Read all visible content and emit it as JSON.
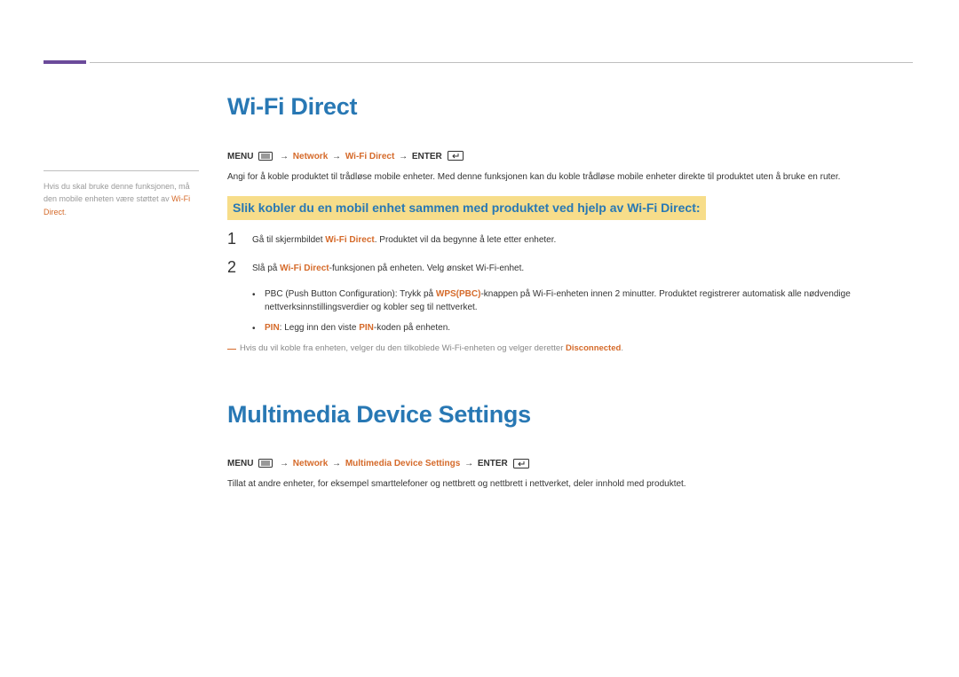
{
  "sidebar": {
    "text_prefix": "Hvis du skal bruke denne funksjonen, må den mobile enheten være støttet av ",
    "highlight": "Wi-Fi Direct",
    "suffix": "."
  },
  "section1": {
    "title": "Wi-Fi Direct",
    "nav_menu": "MENU",
    "nav_network": "Network",
    "nav_item": "Wi-Fi Direct",
    "nav_enter": "ENTER",
    "intro": "Angi for å koble produktet til trådløse mobile enheter. Med denne funksjonen kan du koble trådløse mobile enheter direkte til produktet uten å bruke en ruter.",
    "sub_heading": "Slik kobler du en mobil enhet sammen med produktet ved hjelp av Wi-Fi Direct:",
    "step1_num": "1",
    "step1_prefix": "Gå til skjermbildet ",
    "step1_hl": "Wi-Fi Direct",
    "step1_suffix": ". Produktet vil da begynne å lete etter enheter.",
    "step2_num": "2",
    "step2_prefix": "Slå på ",
    "step2_hl": "Wi-Fi Direct",
    "step2_suffix": "-funksjonen på enheten. Velg ønsket Wi-Fi-enhet.",
    "bullet1_prefix": "PBC (Push Button Configuration): Trykk på ",
    "bullet1_hl": "WPS(PBC)",
    "bullet1_suffix": "-knappen på Wi-Fi-enheten innen 2 minutter. Produktet registrerer automatisk alle nødvendige nettverksinnstillingsverdier og kobler seg til nettverket.",
    "bullet2_hl": "PIN",
    "bullet2_mid": ": Legg inn den viste ",
    "bullet2_hl2": "PIN",
    "bullet2_suffix": "-koden på enheten.",
    "note_prefix": "Hvis du vil koble fra enheten, velger du den tilkoblede Wi-Fi-enheten og velger deretter ",
    "note_hl": "Disconnected",
    "note_suffix": "."
  },
  "section2": {
    "title": "Multimedia Device Settings",
    "nav_menu": "MENU",
    "nav_network": "Network",
    "nav_item": "Multimedia Device Settings",
    "nav_enter": "ENTER",
    "intro": "Tillat at andre enheter, for eksempel smarttelefoner og nettbrett og nettbrett i nettverket, deler innhold med produktet."
  }
}
